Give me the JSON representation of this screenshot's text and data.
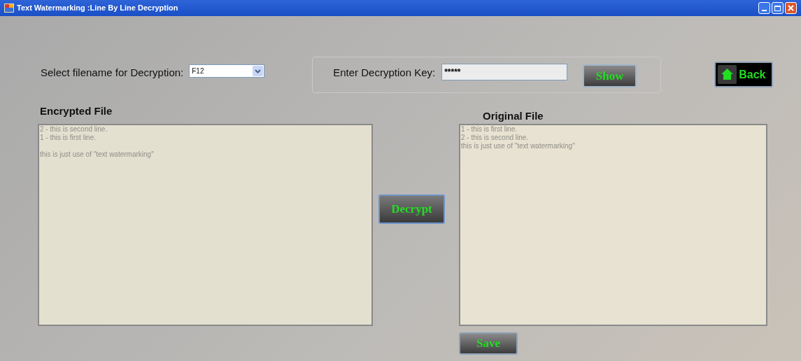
{
  "window": {
    "title": "Text Watermarking :Line By Line Decryption"
  },
  "file_select": {
    "label": "Select filename for Decryption:",
    "value": "F12"
  },
  "key": {
    "label": "Enter Decryption Key:",
    "value": "*****",
    "show_button": "Show"
  },
  "back_button": "Back",
  "encrypted": {
    "label": "Encrypted File",
    "text": "2 - this is second line.\n1 - this is first line.\n\nthis is just use of \"text watermarking\""
  },
  "decrypt_button": "Decrypt",
  "original": {
    "label": "Original File",
    "text": "1 - this is first line.\n2 - this is second line.\nthis is just use of \"text watermarking\""
  },
  "save_button": "Save"
}
